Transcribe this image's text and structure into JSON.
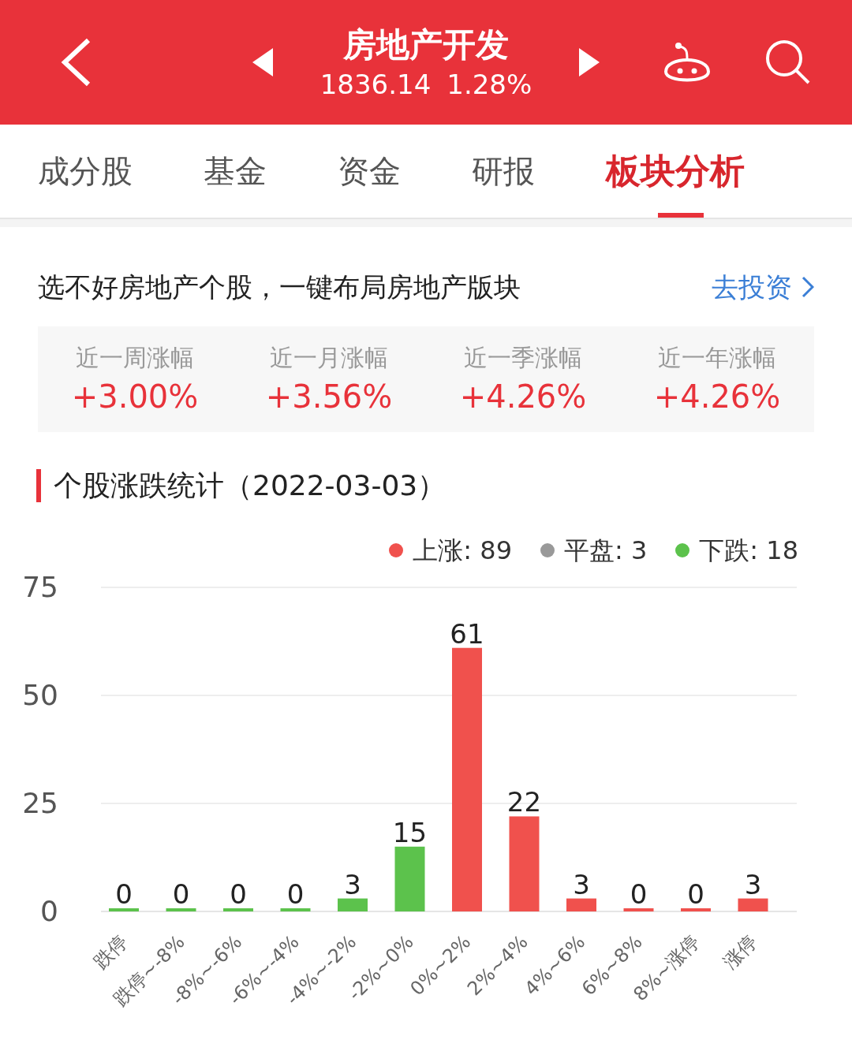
{
  "header": {
    "title": "房地产开发",
    "price": "1836.14",
    "change": "1.28%"
  },
  "tabs": [
    {
      "label": "成分股",
      "selected": false
    },
    {
      "label": "基金",
      "selected": false
    },
    {
      "label": "资金",
      "selected": false
    },
    {
      "label": "研报",
      "selected": false
    },
    {
      "label": "板块分析",
      "selected": true
    }
  ],
  "promo": {
    "text": "选不好房地产个股，一键布局房地产版块",
    "link": "去投资"
  },
  "returns": [
    {
      "label": "近一周涨幅",
      "value": "+3.00%"
    },
    {
      "label": "近一月涨幅",
      "value": "+3.56%"
    },
    {
      "label": "近一季涨幅",
      "value": "+4.26%"
    },
    {
      "label": "近一年涨幅",
      "value": "+4.26%"
    }
  ],
  "stats": {
    "title": "个股涨跌统计（2022-03-03）",
    "legend": [
      {
        "label": "上涨: 89",
        "color": "#f0514d"
      },
      {
        "label": "平盘: 3",
        "color": "#999999"
      },
      {
        "label": "下跌: 18",
        "color": "#5cc24c"
      }
    ],
    "chart_data": {
      "type": "bar",
      "stacked": true,
      "data_labels": true,
      "ylim": [
        0,
        75
      ],
      "yticks": [
        0,
        25,
        50,
        75
      ],
      "categories": [
        "跌停",
        "跌停~-8%",
        "-8%~-6%",
        "-6%~-4%",
        "-4%~-2%",
        "-2%~0%",
        "0%~2%",
        "2%~4%",
        "4%~6%",
        "6%~8%",
        "8%~涨停",
        "涨停"
      ],
      "series": [
        {
          "color": "#5cc24c",
          "values": [
            0,
            0,
            0,
            0,
            3,
            15,
            null,
            null,
            null,
            null,
            null,
            null
          ]
        },
        {
          "color": "#f0514d",
          "values": [
            null,
            null,
            null,
            null,
            null,
            null,
            61,
            22,
            3,
            0,
            0,
            3
          ]
        }
      ]
    }
  }
}
